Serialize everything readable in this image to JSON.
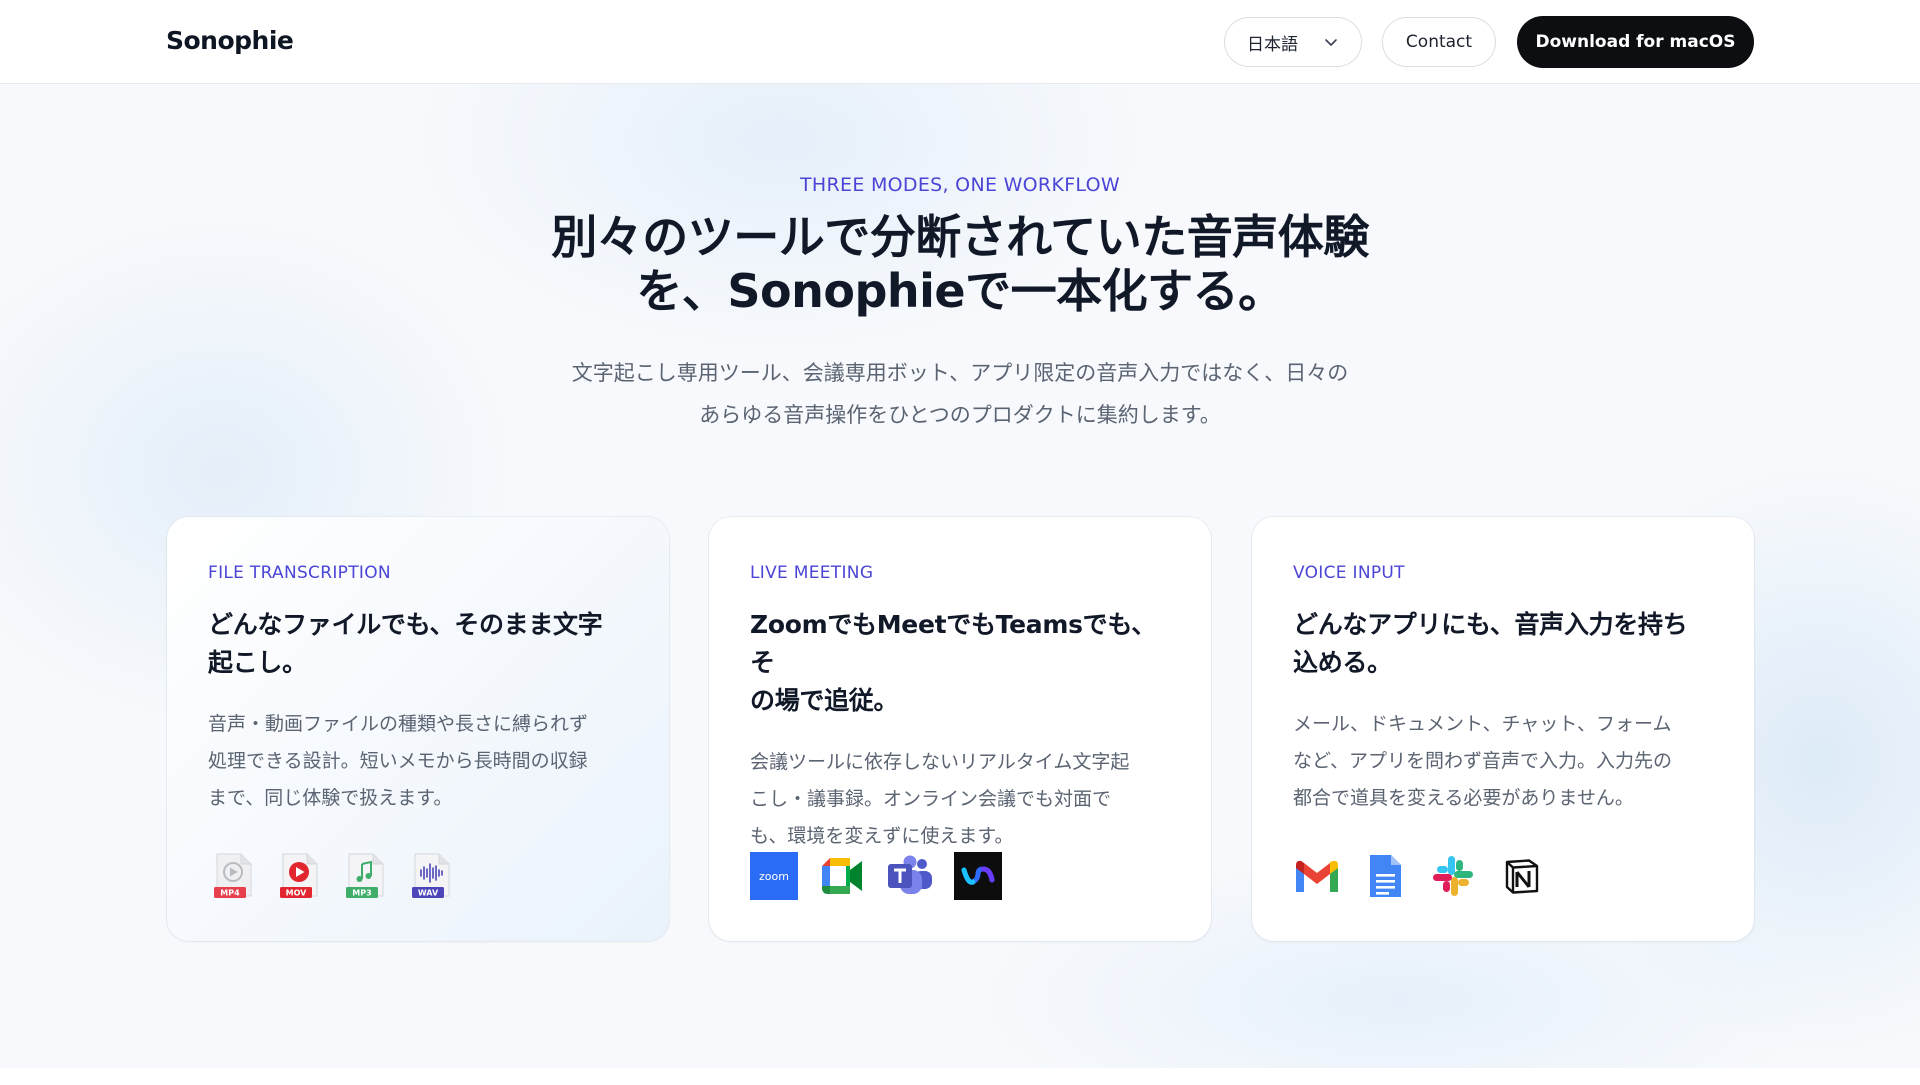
{
  "header": {
    "logo": "Sonophie",
    "language": "日本語",
    "contact_label": "Contact",
    "download_label": "Download for macOS"
  },
  "hero": {
    "eyebrow": "THREE MODES, ONE WORKFLOW",
    "headline_line1": "別々のツールで分断されていた音声体験",
    "headline_line2": "を、Sonophieで一本化する。",
    "sub_line1": "文字起こし専用ツール、会議専用ボット、アプリ限定の音声入力ではなく、日々の",
    "sub_line2": "あらゆる音声操作をひとつのプロダクトに集約します。"
  },
  "cards": [
    {
      "label": "FILE TRANSCRIPTION",
      "title_line1": "どんなファイルでも、そのまま文字",
      "title_line2": "起こし。",
      "body_line1": "音声・動画ファイルの種類や長さに縛られず",
      "body_line2": "処理できる設計。短いメモから長時間の収録",
      "body_line3": "まで、同じ体験で扱えます。",
      "icons": [
        "mp4-file-icon",
        "mov-file-icon",
        "mp3-file-icon",
        "wav-file-icon"
      ],
      "file_badges": [
        "MP4",
        "MOV",
        "MP3",
        "WAV"
      ]
    },
    {
      "label": "LIVE MEETING",
      "title_line1": "ZoomでもMeetでもTeamsでも、そ",
      "title_line2": "の場で追従。",
      "body_line1": "会議ツールに依存しないリアルタイム文字起",
      "body_line2": "こし・議事録。オンライン会議でも対面で",
      "body_line3": "も、環境を変えずに使えます。",
      "icons": [
        "zoom-icon",
        "google-meet-icon",
        "microsoft-teams-icon",
        "webex-icon"
      ],
      "zoom_text": "zoom"
    },
    {
      "label": "VOICE INPUT",
      "title_line1": "どんなアプリにも、音声入力を持ち",
      "title_line2": "込める。",
      "body_line1": "メール、ドキュメント、チャット、フォーム",
      "body_line2": "など、アプリを問わず音声で入力。入力先の",
      "body_line3": "都合で道具を変える必要がありません。",
      "icons": [
        "gmail-icon",
        "google-docs-icon",
        "slack-icon",
        "notion-icon"
      ]
    }
  ],
  "colors": {
    "accent": "#4b45d6",
    "text_primary": "#111827",
    "text_secondary": "#5b6472",
    "download_bg": "#0c0e12"
  }
}
